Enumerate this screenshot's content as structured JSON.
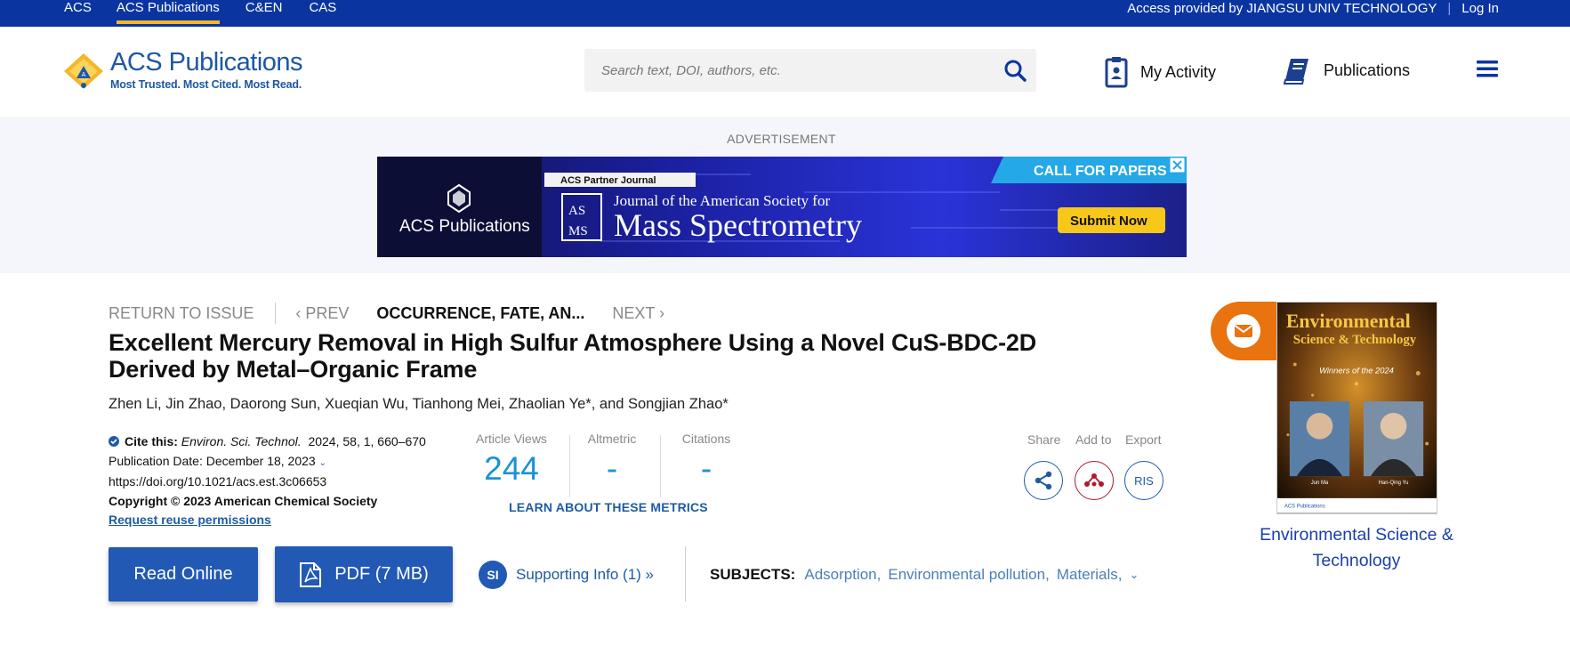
{
  "topbar": {
    "nav": [
      "ACS",
      "ACS Publications",
      "C&EN",
      "CAS"
    ],
    "access_text": "Access provided by JIANGSU UNIV TECHNOLOGY",
    "login": "Log In"
  },
  "header": {
    "logo_word": "ACS Publications",
    "logo_tagline": "Most Trusted. Most Cited. Most Read.",
    "search_placeholder": "Search text, DOI, authors, etc.",
    "my_activity": "My Activity",
    "publications": "Publications"
  },
  "ad": {
    "label": "ADVERTISEMENT",
    "publisher": "ACS Publications",
    "partner": "ACS Partner Journal",
    "journal_line1": "Journal of the American Society for",
    "journal_line2": "Mass Spectrometry",
    "call": "CALL FOR PAPERS",
    "cta": "Submit Now"
  },
  "breadcrumb": {
    "return": "RETURN TO ISSUE",
    "prev": "PREV",
    "current": "OCCURRENCE, FATE, AN...",
    "next": "NEXT"
  },
  "article": {
    "title": "Excellent Mercury Removal in High Sulfur Atmosphere Using a Novel CuS-BDC-2D Derived by Metal–Organic Frame",
    "authors": "Zhen Li, Jin Zhao, Daorong Sun, Xueqian Wu, Tianhong Mei, Zhaolian Ye*, and Songjian Zhao*",
    "cite_label": "Cite this:",
    "cite_journal": "Environ. Sci. Technol.",
    "cite_ref": "2024, 58, 1, 660–670",
    "pub_date": "Publication Date: December 18, 2023",
    "doi": "https://doi.org/10.1021/acs.est.3c06653",
    "copyright": "Copyright © 2023 American Chemical Society",
    "reuse": "Request reuse permissions"
  },
  "metrics": {
    "views_label": "Article Views",
    "views": "244",
    "altmetric_label": "Altmetric",
    "altmetric": "-",
    "citations_label": "Citations",
    "citations": "-",
    "learn": "LEARN ABOUT THESE METRICS"
  },
  "tools": {
    "share": "Share",
    "add_to": "Add to",
    "export": "Export",
    "ris": "RIS"
  },
  "actions": {
    "read_online": "Read Online",
    "pdf": "PDF (7 MB)",
    "si_badge": "SI",
    "supporting": "Supporting Info (1) »"
  },
  "subjects": {
    "label": "SUBJECTS:",
    "items": [
      "Adsorption",
      "Environmental pollution",
      "Materials"
    ]
  },
  "sidebar": {
    "journal_name": "Environmental Science & Technology",
    "cover_title_1": "Environmental",
    "cover_title_2": "Science & Technology",
    "cover_banner": "Winners of the 2024",
    "person_1": "Jun Ma",
    "person_2": "Han-Qing Yu",
    "cover_footer": "ACS Publications"
  },
  "colors": {
    "topbar": "#0a35a1",
    "accent_underline": "#f5b728",
    "button_blue": "#2259b5",
    "link_blue": "#1e5ba3",
    "metric_blue": "#1992d8",
    "mail_orange": "#e8730f"
  }
}
